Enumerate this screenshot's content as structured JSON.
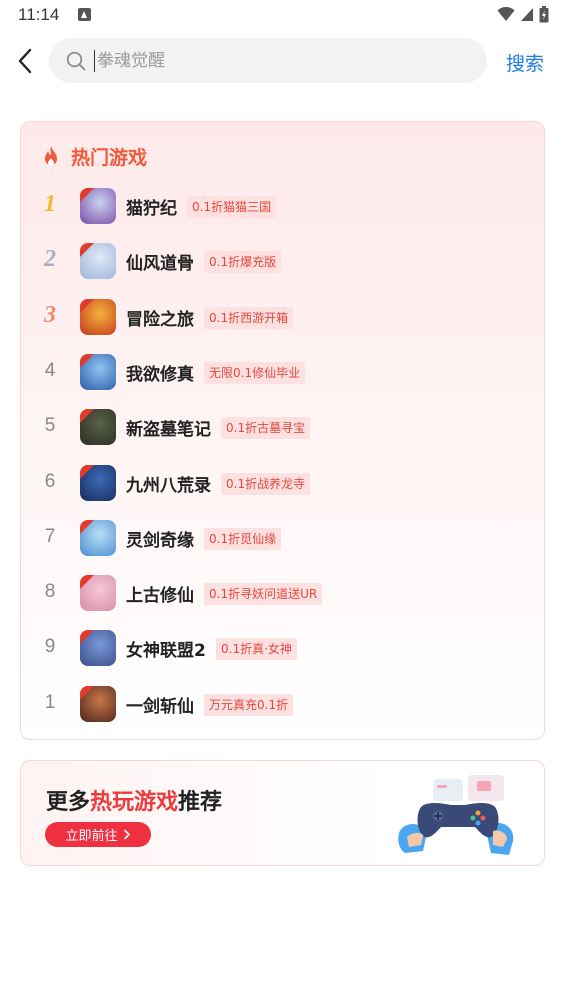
{
  "status_bar": {
    "time": "11:14"
  },
  "search": {
    "placeholder": "拳魂觉醒",
    "value": "",
    "button_label": "搜索"
  },
  "hot_games": {
    "title": "热门游戏",
    "items": [
      {
        "rank": "1",
        "name": "猫狞纪",
        "tag": "0.1折猫猫三国",
        "icon_colors": [
          "#c9d4f0",
          "#7a4aa8"
        ]
      },
      {
        "rank": "2",
        "name": "仙风道骨",
        "tag": "0.1折爆充版",
        "icon_colors": [
          "#dfe8f6",
          "#9cb3d8"
        ]
      },
      {
        "rank": "3",
        "name": "冒险之旅",
        "tag": "0.1折西游开箱",
        "icon_colors": [
          "#f4b23a",
          "#c2361e"
        ]
      },
      {
        "rank": "4",
        "name": "我欲修真",
        "tag": "无限0.1修仙毕业",
        "icon_colors": [
          "#8fc4f2",
          "#2c5aa8"
        ]
      },
      {
        "rank": "5",
        "name": "新盗墓笔记",
        "tag": "0.1折古墓寻宝",
        "icon_colors": [
          "#5a6248",
          "#2a2c24"
        ]
      },
      {
        "rank": "6",
        "name": "九州八荒录",
        "tag": "0.1折战养龙寺",
        "icon_colors": [
          "#3a6ab8",
          "#1a2a58"
        ]
      },
      {
        "rank": "7",
        "name": "灵剑奇缘",
        "tag": "0.1折觅仙缘",
        "icon_colors": [
          "#b8e0f4",
          "#4a8ad0"
        ]
      },
      {
        "rank": "8",
        "name": "上古修仙",
        "tag": "0.1折寻妖问道送UR",
        "icon_colors": [
          "#f4c8d8",
          "#d88aa8"
        ]
      },
      {
        "rank": "9",
        "name": "女神联盟2",
        "tag": "0.1折真·女神",
        "icon_colors": [
          "#7a9ad8",
          "#3a4a88"
        ]
      },
      {
        "rank": "1",
        "name": "一剑斩仙",
        "tag": "万元真充0.1折",
        "icon_colors": [
          "#c8784a",
          "#4a2418"
        ]
      }
    ]
  },
  "promo": {
    "title_prefix": "更多",
    "title_highlight": "热玩游戏",
    "title_suffix": "推荐",
    "button_label": "立即前往",
    "button_icon": "chevron-right-icon"
  },
  "colors": {
    "accent_blue": "#1e7be8",
    "accent_red": "#ef3040",
    "title_orange": "#f05a3a",
    "tag_text": "#e5483e",
    "tag_bg": "#fde0e0"
  }
}
